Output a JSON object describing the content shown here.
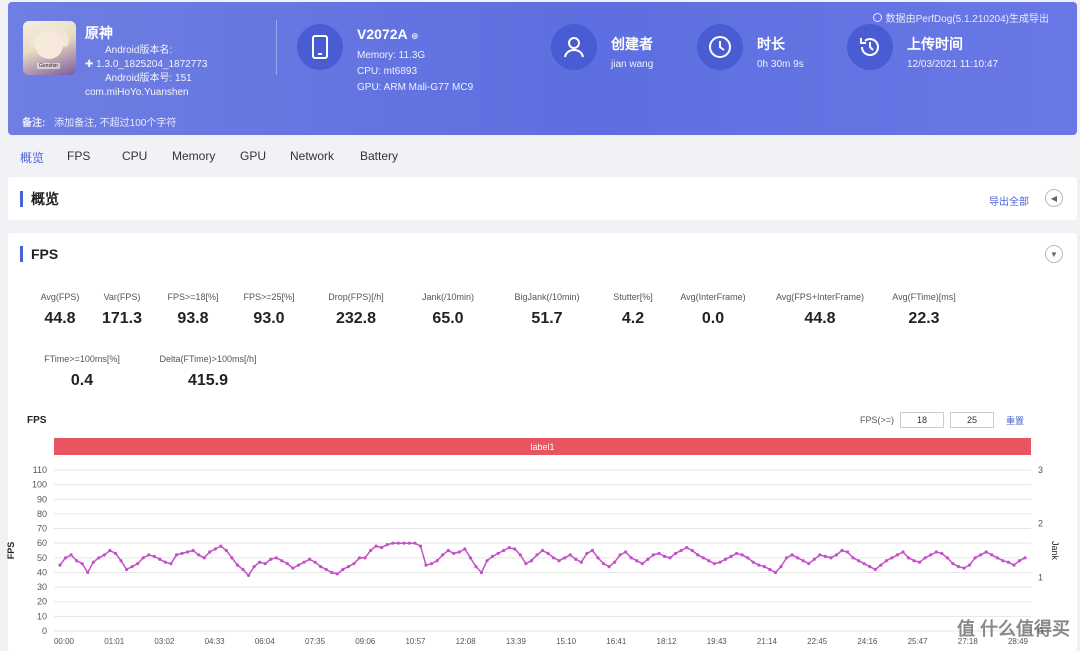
{
  "header": {
    "watermark": "数据由PerfDog(5.1.210204)生成导出",
    "app": {
      "name": "原神",
      "android_version_name": "Android版本名:",
      "version_value": "1.3.0_1825204_1872773",
      "android_version_code": "Android版本号: 151",
      "package": "com.miHoYo.Yuanshen"
    },
    "device": {
      "model": "V2072A",
      "memory": "Memory: 11.3G",
      "cpu": "CPU: mt6893",
      "gpu": "GPU: ARM Mali-G77 MC9"
    },
    "creator": {
      "title": "创建者",
      "value": "jian wang"
    },
    "duration": {
      "title": "时长",
      "value": "0h 30m 9s"
    },
    "upload": {
      "title": "上传时间",
      "value": "12/03/2021 11:10:47"
    },
    "note_label": "备注:",
    "note_placeholder": "添加备注, 不超过100个字符"
  },
  "tabs": [
    "概览",
    "FPS",
    "CPU",
    "Memory",
    "GPU",
    "Network",
    "Battery"
  ],
  "overview": {
    "title": "概览",
    "export_label": "导出全部"
  },
  "fps_section": {
    "title": "FPS",
    "metrics_row1": [
      {
        "label": "Avg(FPS)",
        "value": "44.8"
      },
      {
        "label": "Var(FPS)",
        "value": "171.3"
      },
      {
        "label": "FPS>=18[%]",
        "value": "93.8"
      },
      {
        "label": "FPS>=25[%]",
        "value": "93.0"
      },
      {
        "label": "Drop(FPS)[/h]",
        "value": "232.8"
      },
      {
        "label": "Jank(/10min)",
        "value": "65.0"
      },
      {
        "label": "BigJank(/10min)",
        "value": "51.7"
      },
      {
        "label": "Stutter[%]",
        "value": "4.2"
      },
      {
        "label": "Avg(InterFrame)",
        "value": "0.0"
      },
      {
        "label": "Avg(FPS+InterFrame)",
        "value": "44.8"
      },
      {
        "label": "Avg(FTime)[ms]",
        "value": "22.3"
      }
    ],
    "metrics_row2": [
      {
        "label": "FTime>=100ms[%]",
        "value": "0.4"
      },
      {
        "label": "Delta(FTime)>100ms[/h]",
        "value": "415.9"
      }
    ],
    "chart_title": "FPS",
    "range_label": "FPS(>=)",
    "range_low": "18",
    "range_high": "25",
    "reset_label": "重置",
    "band_label": "label1"
  },
  "chart_data": {
    "type": "line",
    "ylabel": "FPS",
    "y2label": "Jank",
    "ylim": [
      0,
      110
    ],
    "y2lim": [
      0,
      3
    ],
    "yticks": [
      "0",
      "10",
      "20",
      "30",
      "40",
      "50",
      "60",
      "70",
      "80",
      "90",
      "100",
      "110"
    ],
    "y2ticks": [
      "0",
      "1",
      "2",
      "3"
    ],
    "xticks": [
      "00:00",
      "01:01",
      "03:02",
      "04:33",
      "06:04",
      "07:35",
      "09:06",
      "10:57",
      "12:08",
      "13:39",
      "15:10",
      "16:41",
      "18:12",
      "19:43",
      "21:14",
      "22:45",
      "24:16",
      "25:47",
      "27:18",
      "28:49"
    ],
    "series": [
      {
        "name": "FPS",
        "color": "#c44fc9",
        "values": [
          45,
          50,
          52,
          48,
          46,
          40,
          47,
          50,
          52,
          55,
          53,
          48,
          42,
          44,
          46,
          50,
          52,
          51,
          49,
          47,
          46,
          52,
          53,
          54,
          55,
          52,
          50,
          54,
          56,
          58,
          55,
          50,
          45,
          42,
          38,
          44,
          47,
          46,
          49,
          50,
          48,
          46,
          43,
          45,
          47,
          49,
          47,
          44,
          42,
          40,
          39,
          42,
          44,
          46,
          50,
          50,
          55,
          58,
          57,
          59,
          60,
          60,
          60,
          60,
          60,
          58,
          45,
          46,
          48,
          52,
          55,
          53,
          54,
          56,
          50,
          44,
          40,
          48,
          51,
          53,
          55,
          57,
          56,
          52,
          46,
          48,
          52,
          55,
          53,
          50,
          48,
          50,
          52,
          49,
          47,
          53,
          55,
          50,
          46,
          44,
          47,
          52,
          54,
          50,
          48,
          46,
          49,
          52,
          53,
          51,
          50,
          53,
          55,
          57,
          55,
          52,
          50,
          48,
          46,
          47,
          49,
          51,
          53,
          52,
          50,
          47,
          45,
          44,
          42,
          40,
          44,
          50,
          52,
          50,
          48,
          46,
          49,
          52,
          51,
          50,
          52,
          55,
          54,
          50,
          48,
          46,
          44,
          42,
          45,
          48,
          50,
          52,
          54,
          50,
          48,
          47,
          50,
          52,
          54,
          53,
          50,
          46,
          44,
          43,
          45,
          50,
          52,
          54,
          52,
          50,
          48,
          47,
          45,
          48,
          50
        ]
      }
    ]
  },
  "watermark_bottom": "值 什么值得买"
}
